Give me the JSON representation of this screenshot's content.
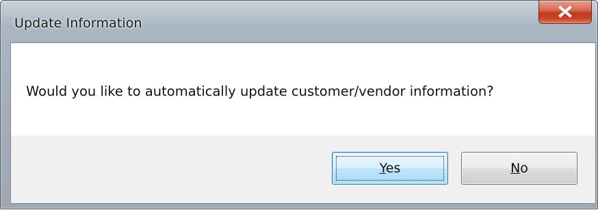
{
  "window": {
    "title": "Update Information"
  },
  "titlebar": {
    "close_icon": "close-x-icon",
    "close_color": "#c9482b"
  },
  "dialog": {
    "message": "Would you like to automatically update customer/vendor information?"
  },
  "buttons": {
    "yes": {
      "accel": "Y",
      "rest": "es",
      "default": true
    },
    "no": {
      "accel": "N",
      "rest": "o",
      "default": false
    }
  },
  "colors": {
    "frame": "#a3adb6",
    "client_bg": "#f0f0f0",
    "message_bg": "#ffffff",
    "default_button_border": "#3c7fb1"
  }
}
